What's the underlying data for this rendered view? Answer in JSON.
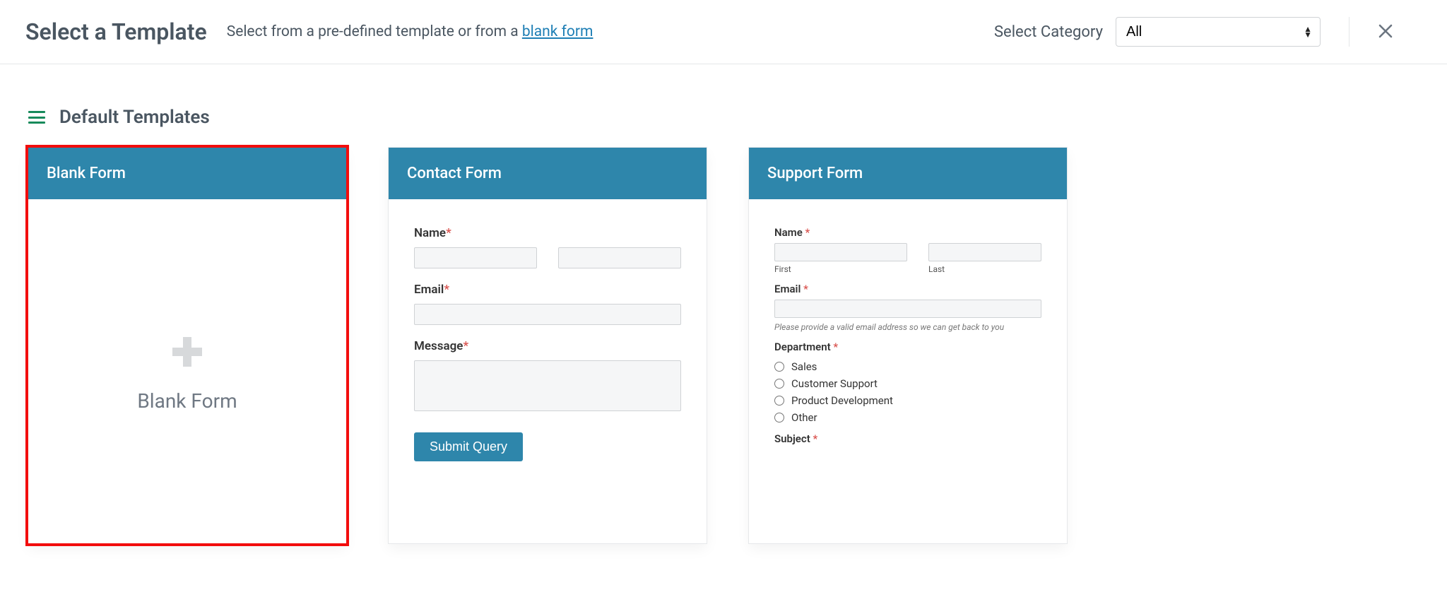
{
  "header": {
    "title": "Select a Template",
    "subtitle_pre": "Select from a pre-defined template or from a ",
    "subtitle_link": "blank form",
    "category_label": "Select Category",
    "category_value": "All"
  },
  "section": {
    "title": "Default Templates"
  },
  "cards": {
    "blank": {
      "title": "Blank Form",
      "body_label": "Blank Form"
    },
    "contact": {
      "title": "Contact Form",
      "name_label": "Name",
      "email_label": "Email",
      "message_label": "Message",
      "submit_label": "Submit Query"
    },
    "support": {
      "title": "Support Form",
      "name_label": "Name",
      "first_label": "First",
      "last_label": "Last",
      "email_label": "Email",
      "email_hint": "Please provide a valid email address so we can get back to you",
      "department_label": "Department",
      "dept_options": {
        "0": "Sales",
        "1": "Customer Support",
        "2": "Product Development",
        "3": "Other"
      },
      "subject_label": "Subject"
    }
  },
  "req": "*"
}
